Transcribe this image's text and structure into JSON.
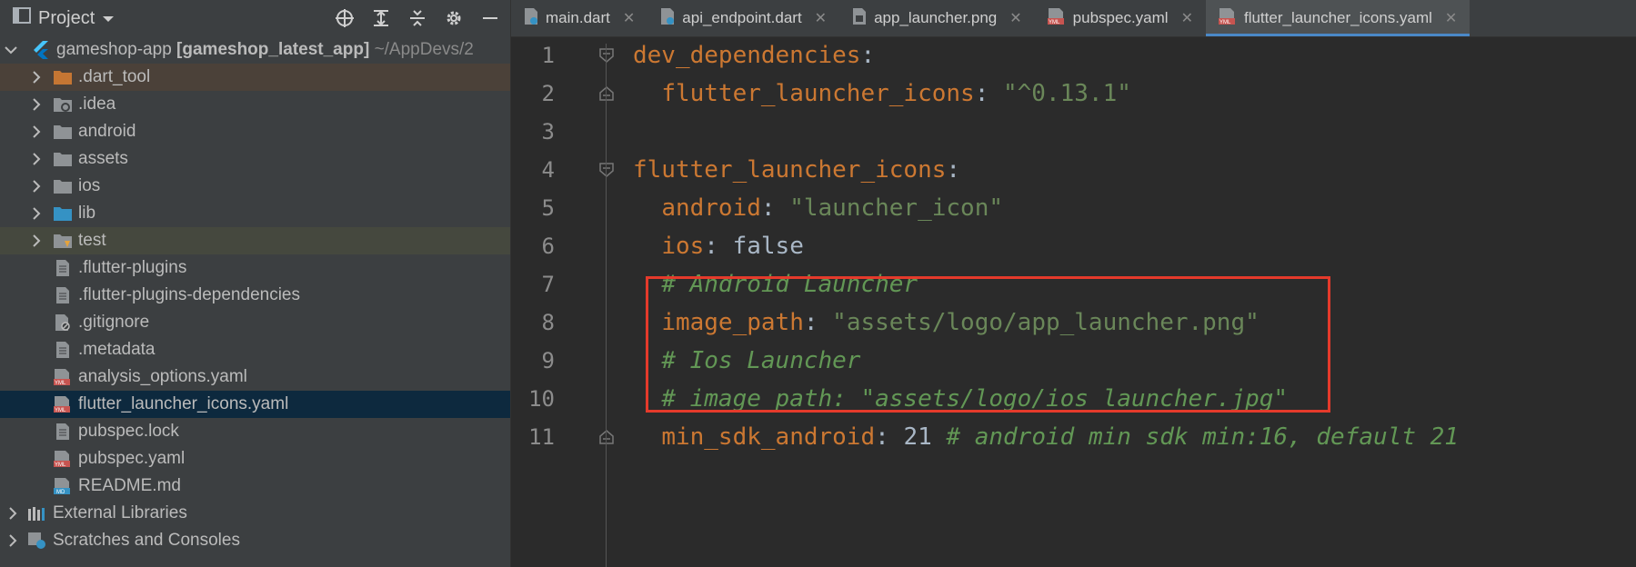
{
  "sidebar": {
    "title": "Project",
    "project_name": "gameshop-app",
    "project_module": "[gameshop_latest_app]",
    "project_path": "~/AppDevs/2",
    "items": [
      {
        "label": ".dart_tool",
        "icon": "folder-orange-icon"
      },
      {
        "label": ".idea",
        "icon": "folder-settings-icon"
      },
      {
        "label": "android",
        "icon": "folder-icon"
      },
      {
        "label": "assets",
        "icon": "folder-icon"
      },
      {
        "label": "ios",
        "icon": "folder-icon"
      },
      {
        "label": "lib",
        "icon": "folder-blue-icon"
      },
      {
        "label": "test",
        "icon": "folder-test-icon"
      },
      {
        "label": ".flutter-plugins",
        "icon": "file-icon"
      },
      {
        "label": ".flutter-plugins-dependencies",
        "icon": "file-icon"
      },
      {
        "label": ".gitignore",
        "icon": "file-ignore-icon"
      },
      {
        "label": ".metadata",
        "icon": "file-icon"
      },
      {
        "label": "analysis_options.yaml",
        "icon": "yaml-icon"
      },
      {
        "label": "flutter_launcher_icons.yaml",
        "icon": "yaml-icon"
      },
      {
        "label": "pubspec.lock",
        "icon": "file-icon"
      },
      {
        "label": "pubspec.yaml",
        "icon": "yaml-icon"
      },
      {
        "label": "README.md",
        "icon": "markdown-icon"
      }
    ],
    "external_libraries": "External Libraries",
    "scratches": "Scratches and Consoles"
  },
  "tabs": [
    {
      "label": "main.dart"
    },
    {
      "label": "api_endpoint.dart"
    },
    {
      "label": "app_launcher.png"
    },
    {
      "label": "pubspec.yaml"
    },
    {
      "label": "flutter_launcher_icons.yaml"
    }
  ],
  "editor": {
    "line_numbers": [
      "1",
      "2",
      "3",
      "4",
      "5",
      "6",
      "7",
      "8",
      "9",
      "10",
      "11"
    ],
    "l1_key": "dev_dependencies",
    "l2_key": "flutter_launcher_icons",
    "l2_val": "\"^0.13.1\"",
    "l4_key": "flutter_launcher_icons",
    "l5_key": "android",
    "l5_val": "\"launcher_icon\"",
    "l6_key": "ios",
    "l6_val": "false",
    "l7_comment": "# Android Launcher",
    "l8_key": "image_path",
    "l8_val": "\"assets/logo/app_launcher.png\"",
    "l9_comment": "# Ios Launcher",
    "l10_comment": "# image_path: \"assets/logo/ios_launcher.jpg\"",
    "l11_key": "min_sdk_android",
    "l11_val": "21",
    "l11_comment": "# android min sdk min:16, default 21"
  },
  "colors": {
    "highlight_box": "#e53a2b",
    "active_tab_underline": "#4a88c7",
    "key": "#cc7832",
    "string": "#6a8759",
    "comment": "#629755"
  }
}
